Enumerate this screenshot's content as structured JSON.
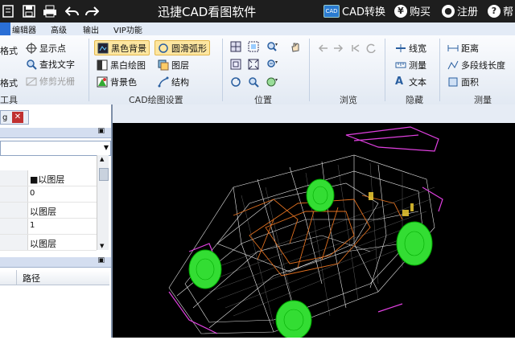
{
  "app": {
    "title": "迅捷CAD看图软件",
    "cad_convert": "CAD转换",
    "buy": "购买",
    "register": "注册",
    "help_partial": "帮",
    "cad_badge": "CAD"
  },
  "tabs": {
    "items": [
      "编辑器",
      "高级",
      "输出",
      "VIP功能"
    ]
  },
  "ribbon": {
    "left_partial": {
      "row1": "格式",
      "row2": "格式",
      "group": "工具"
    },
    "tools": {
      "show_points": "显示点",
      "find_text": "查找文字",
      "trim_light": "修剪光栅"
    },
    "cad_settings": {
      "black_bg": "黑色背景",
      "smooth_arc": "圆滑弧形",
      "bw_draw": "黑白绘图",
      "layers": "图层",
      "bg_color": "背景色",
      "structure": "结构",
      "group": "CAD绘图设置"
    },
    "position": {
      "group": "位置"
    },
    "browse": {
      "group": "浏览"
    },
    "hide": {
      "line_width": "线宽",
      "measure": "测量",
      "text": "文本",
      "group": "隐藏"
    },
    "measure": {
      "distance": "距离",
      "polyline_length": "多段线长度",
      "area": "面积",
      "group": "测量"
    }
  },
  "document": {
    "tab_partial": "g",
    "close": "✕"
  },
  "properties": {
    "rows": [
      {
        "value": "■以图层"
      },
      {
        "value": "0"
      },
      {
        "value": "以图层"
      },
      {
        "value": "1"
      },
      {
        "value": "以图层"
      }
    ]
  },
  "file_list": {
    "col_path": "路径"
  },
  "colors": {
    "titlebar": "#1e1e1e",
    "ribbon": "#e2e9f3",
    "canvas": "#000000",
    "wheel": "#33dd33",
    "wire_white": "#ffffff",
    "wire_magenta": "#e040e0",
    "wire_orange": "#e07020"
  }
}
